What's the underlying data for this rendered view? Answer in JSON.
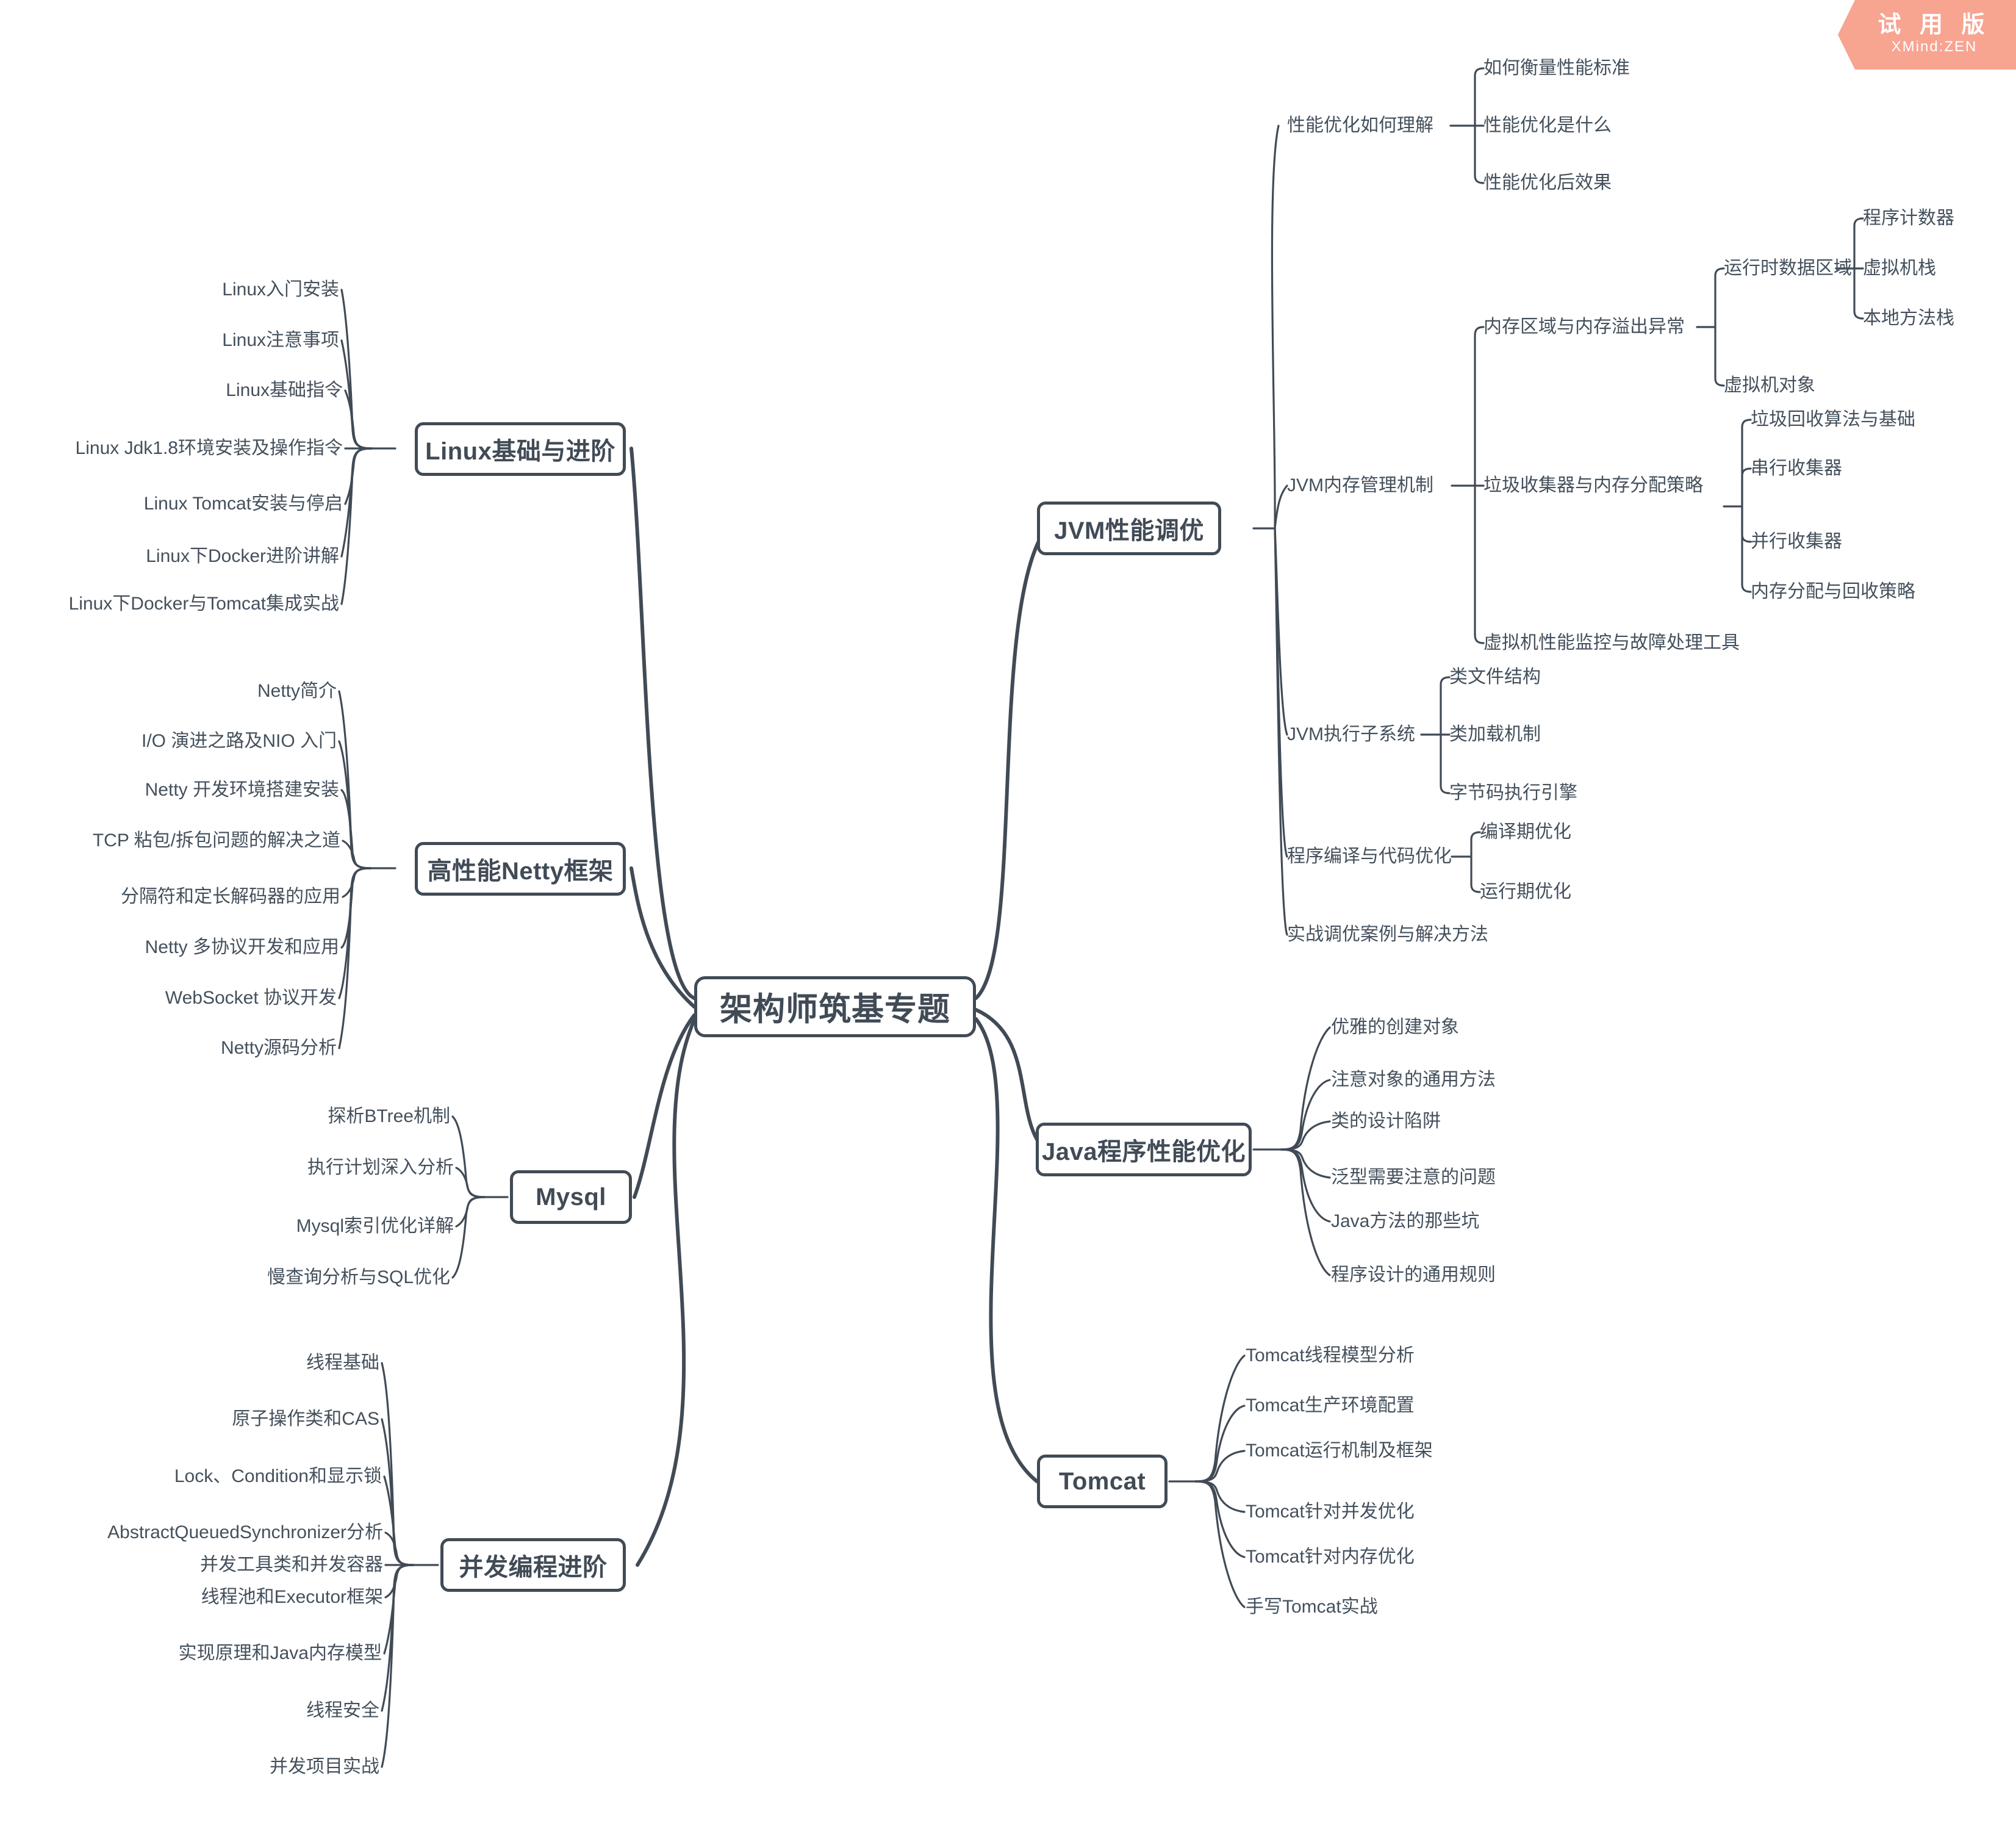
{
  "app": {
    "watermark_main": "试 用 版",
    "watermark_sub": "XMind:ZEN",
    "accent_color": "#f7a491",
    "line_color": "#414b56",
    "text_color": "#44505c",
    "background": "#ffffff"
  },
  "mindmap": {
    "root": "架构师筑基专题",
    "branches": [
      {
        "title": "Linux基础与进阶",
        "side": "left",
        "children": [
          {
            "label": "Linux入门安装"
          },
          {
            "label": "Linux注意事项"
          },
          {
            "label": "Linux基础指令"
          },
          {
            "label": "Linux Jdk1.8环境安装及操作指令"
          },
          {
            "label": "Linux Tomcat安装与停启"
          },
          {
            "label": "Linux下Docker进阶讲解"
          },
          {
            "label": "Linux下Docker与Tomcat集成实战"
          }
        ]
      },
      {
        "title": "高性能Netty框架",
        "side": "left",
        "children": [
          {
            "label": "Netty简介"
          },
          {
            "label": "I/O 演进之路及NIO 入门"
          },
          {
            "label": "Netty 开发环境搭建安装"
          },
          {
            "label": "TCP 粘包/拆包问题的解决之道"
          },
          {
            "label": "分隔符和定长解码器的应用"
          },
          {
            "label": "Netty 多协议开发和应用"
          },
          {
            "label": "WebSocket 协议开发"
          },
          {
            "label": "Netty源码分析"
          }
        ]
      },
      {
        "title": "Mysql",
        "side": "left",
        "children": [
          {
            "label": "探析BTree机制"
          },
          {
            "label": "执行计划深入分析"
          },
          {
            "label": "Mysql索引优化详解"
          },
          {
            "label": "慢查询分析与SQL优化"
          }
        ]
      },
      {
        "title": "并发编程进阶",
        "side": "left",
        "children": [
          {
            "label": "线程基础"
          },
          {
            "label": "原子操作类和CAS"
          },
          {
            "label": "Lock、Condition和显示锁"
          },
          {
            "label": "AbstractQueuedSynchronizer分析"
          },
          {
            "label": "并发工具类和并发容器"
          },
          {
            "label": "线程池和Executor框架"
          },
          {
            "label": "实现原理和Java内存模型"
          },
          {
            "label": "线程安全"
          },
          {
            "label": "并发项目实战"
          }
        ]
      },
      {
        "title": "JVM性能调优",
        "side": "right",
        "children": [
          {
            "label": "性能优化如何理解",
            "children": [
              {
                "label": "如何衡量性能标准"
              },
              {
                "label": "性能优化是什么"
              },
              {
                "label": "性能优化后效果"
              }
            ]
          },
          {
            "label": "JVM内存管理机制",
            "children": [
              {
                "label": "内存区域与内存溢出异常",
                "children": [
                  {
                    "label": "运行时数据区域",
                    "children": [
                      {
                        "label": "程序计数器"
                      },
                      {
                        "label": "虚拟机栈"
                      },
                      {
                        "label": "本地方法栈"
                      }
                    ]
                  },
                  {
                    "label": "虚拟机对象"
                  }
                ]
              },
              {
                "label": "垃圾收集器与内存分配策略",
                "children": [
                  {
                    "label": "垃圾回收算法与基础"
                  },
                  {
                    "label": "串行收集器"
                  },
                  {
                    "label": "并行收集器"
                  },
                  {
                    "label": "内存分配与回收策略"
                  }
                ]
              },
              {
                "label": "虚拟机性能监控与故障处理工具"
              }
            ]
          },
          {
            "label": "JVM执行子系统",
            "children": [
              {
                "label": "类文件结构"
              },
              {
                "label": "类加载机制"
              },
              {
                "label": "字节码执行引擎"
              }
            ]
          },
          {
            "label": "程序编译与代码优化",
            "children": [
              {
                "label": "编译期优化"
              },
              {
                "label": "运行期优化"
              }
            ]
          },
          {
            "label": "实战调优案例与解决方法"
          }
        ]
      },
      {
        "title": "Java程序性能优化",
        "side": "right",
        "children": [
          {
            "label": "优雅的创建对象"
          },
          {
            "label": "注意对象的通用方法"
          },
          {
            "label": "类的设计陷阱"
          },
          {
            "label": "泛型需要注意的问题"
          },
          {
            "label": "Java方法的那些坑"
          },
          {
            "label": "程序设计的通用规则"
          }
        ]
      },
      {
        "title": "Tomcat",
        "side": "right",
        "children": [
          {
            "label": "Tomcat线程模型分析"
          },
          {
            "label": "Tomcat生产环境配置"
          },
          {
            "label": "Tomcat运行机制及框架"
          },
          {
            "label": "Tomcat针对并发优化"
          },
          {
            "label": "Tomcat针对内存优化"
          },
          {
            "label": "手写Tomcat实战"
          }
        ]
      }
    ]
  }
}
